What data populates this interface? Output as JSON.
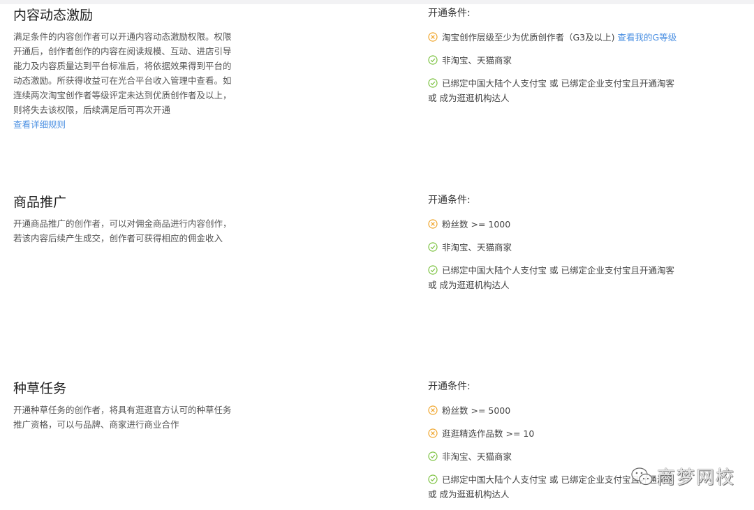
{
  "colors": {
    "accent_link": "#4a8fe2",
    "cross_icon": "#f0a52a",
    "check_icon": "#7cc240"
  },
  "sections": [
    {
      "title": "内容动态激励",
      "desc_lines": [
        "满足条件的内容创作者可以开通内容动态激励权限。权限",
        "开通后，创作者创作的内容在阅读规模、互动、进店引导",
        "能力及内容质量达到平台标准后，将依据效果得到平台的",
        "动态激励。所获得收益可在光合平台收入管理中查看。如",
        "连续两次淘宝创作者等级评定未达到优质创作者及以上，",
        "则将失去该权限，后续满足后可再次开通"
      ],
      "desc_link": "查看详细规则",
      "cond_label": "开通条件:",
      "conds": [
        {
          "icon": "cross-icon",
          "text": "淘宝创作层级至少为优质创作者（G3及以上)",
          "link": "查看我的G等级"
        },
        {
          "icon": "check-icon",
          "text": "非淘宝、天猫商家"
        },
        {
          "icon": "check-icon",
          "text": "已绑定中国大陆个人支付宝 或 已绑定企业支付宝且开通淘客",
          "text2": "或 成为逛逛机构达人"
        }
      ]
    },
    {
      "title": "商品推广",
      "desc_lines": [
        "开通商品推广的创作者，可以对佣金商品进行内容创作，",
        "若该内容后续产生成交，创作者可获得相应的佣金收入"
      ],
      "cond_label": "开通条件:",
      "conds": [
        {
          "icon": "cross-icon",
          "text": "粉丝数 >= 1000"
        },
        {
          "icon": "check-icon",
          "text": "非淘宝、天猫商家"
        },
        {
          "icon": "check-icon",
          "text": "已绑定中国大陆个人支付宝 或 已绑定企业支付宝且开通淘客",
          "text2": "或 成为逛逛机构达人"
        }
      ]
    },
    {
      "title": "种草任务",
      "desc_lines": [
        "开通种草任务的创作者，将具有逛逛官方认可的种草任务",
        "推广资格，可以与品牌、商家进行商业合作"
      ],
      "cond_label": "开通条件:",
      "conds": [
        {
          "icon": "cross-icon",
          "text": "粉丝数 >= 5000"
        },
        {
          "icon": "cross-icon",
          "text": "逛逛精选作品数 >= 10"
        },
        {
          "icon": "check-icon",
          "text": "非淘宝、天猫商家"
        },
        {
          "icon": "check-icon",
          "text": "已绑定中国大陆个人支付宝 或 已绑定企业支付宝且开通淘客",
          "text2": "或 成为逛逛机构达人"
        }
      ]
    }
  ],
  "watermark": {
    "icon": "wechat-icon",
    "text": "商梦网校"
  }
}
